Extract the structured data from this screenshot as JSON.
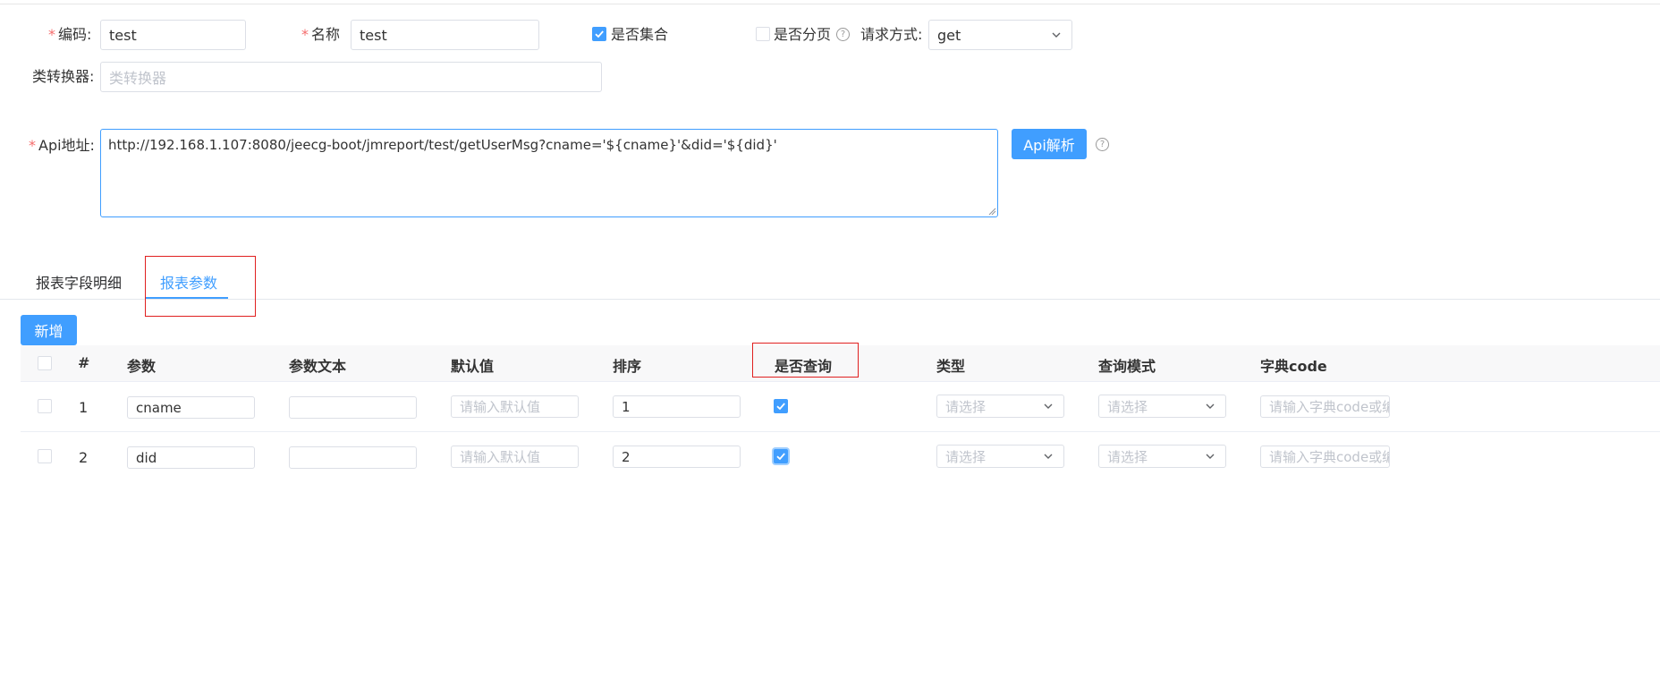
{
  "form": {
    "code_label": "编码:",
    "code_value": "test",
    "name_label": "名称",
    "name_value": "test",
    "is_collection_label": "是否集合",
    "is_collection_checked": true,
    "is_paging_label": "是否分页",
    "is_paging_checked": false,
    "help_glyph": "?",
    "request_method_label": "请求方式:",
    "request_method_value": "get",
    "converter_label": "类转换器:",
    "converter_placeholder": "类转换器",
    "api_label": "Api地址:",
    "api_value": "http://192.168.1.107:8080/jeecg-boot/jmreport/test/getUserMsg?cname='${cname}'&did='${did}'",
    "api_parse_button": "Api解析",
    "required_mark": "*"
  },
  "tabs": [
    {
      "label": "报表字段明细",
      "active": false
    },
    {
      "label": "报表参数",
      "active": true
    }
  ],
  "toolbar": {
    "add_button": "新增"
  },
  "table": {
    "columns": [
      "#",
      "参数",
      "参数文本",
      "默认值",
      "排序",
      "是否查询",
      "类型",
      "查询模式",
      "字典code"
    ],
    "rows": [
      {
        "index": "1",
        "param": "cname",
        "param_text": "",
        "default_placeholder": "请输入默认值",
        "order": "1",
        "is_query": true,
        "type_placeholder": "请选择",
        "mode_placeholder": "请选择",
        "dict_placeholder": "请输入字典code或编码"
      },
      {
        "index": "2",
        "param": "did",
        "param_text": "",
        "default_placeholder": "请输入默认值",
        "order": "2",
        "is_query": true,
        "type_placeholder": "请选择",
        "mode_placeholder": "请选择",
        "dict_placeholder": "请输入字典code或编码"
      }
    ]
  },
  "colors": {
    "primary": "#409eff",
    "required": "#f56c6c",
    "highlight_box": "#e02020",
    "border": "#dcdfe6"
  },
  "icons": {
    "checkmark": "check-icon",
    "dropdown": "chevron-down-icon",
    "help": "question-circle-icon"
  }
}
